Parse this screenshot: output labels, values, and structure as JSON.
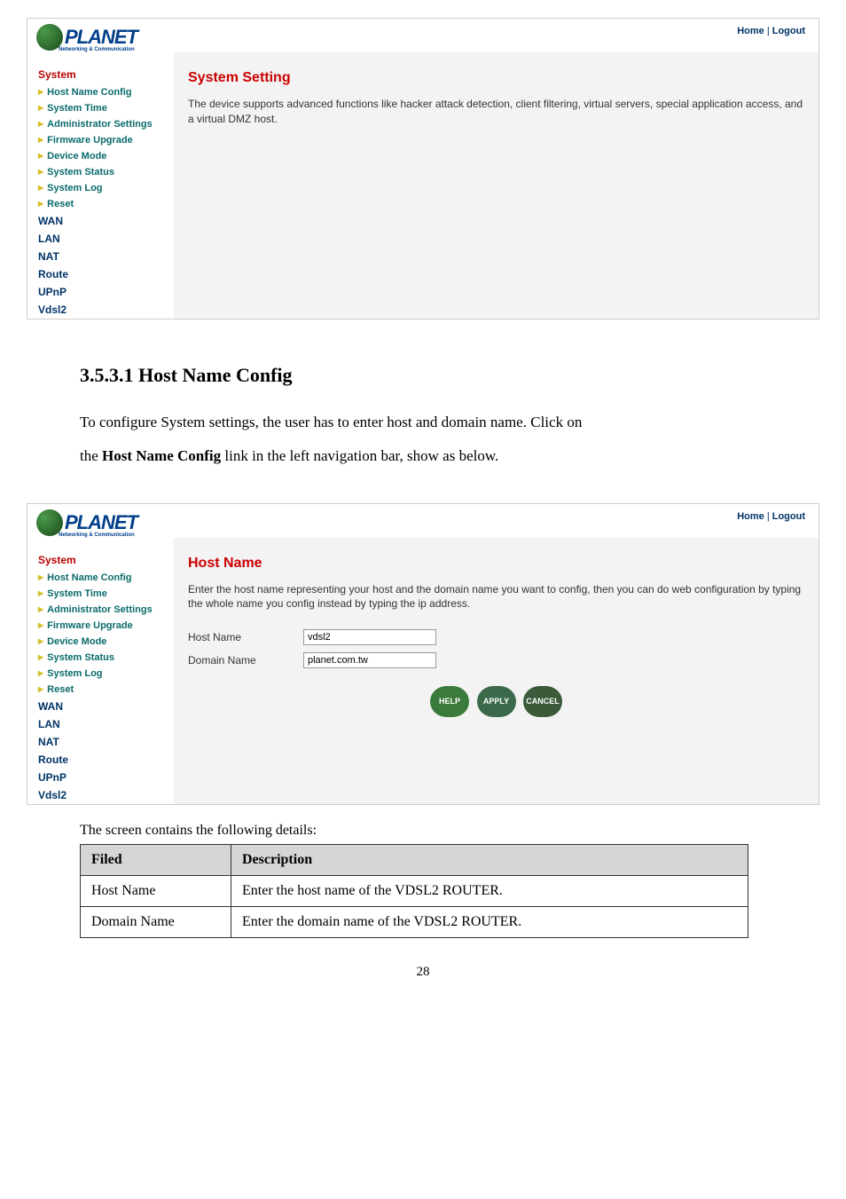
{
  "screenshot1": {
    "topbar": {
      "home": "Home",
      "sep": " | ",
      "logout": "Logout"
    },
    "logo": {
      "text": "PLANET",
      "sub": "Networking & Communication"
    },
    "sidebar": {
      "system": "System",
      "subs": [
        "Host Name Config",
        "System Time",
        "Administrator Settings",
        "Firmware Upgrade",
        "Device Mode",
        "System Status",
        "System Log",
        "Reset"
      ],
      "mains": [
        "WAN",
        "LAN",
        "NAT",
        "Route",
        "UPnP",
        "Vdsl2"
      ]
    },
    "content": {
      "title": "System Setting",
      "desc": "The device supports advanced functions like hacker attack detection, client filtering, virtual servers, special application access, and a virtual DMZ host."
    }
  },
  "mid": {
    "heading": "3.5.3.1 Host Name Config",
    "para1": "To configure System settings, the user has to enter host and domain name. Click on",
    "para2a": "the ",
    "para2b": "Host Name Config",
    "para2c": " link in the left navigation bar, show as below."
  },
  "screenshot2": {
    "topbar": {
      "home": "Home",
      "sep": " | ",
      "logout": "Logout"
    },
    "logo": {
      "text": "PLANET",
      "sub": "Networking & Communication"
    },
    "sidebar": {
      "system": "System",
      "subs": [
        "Host Name Config",
        "System Time",
        "Administrator Settings",
        "Firmware Upgrade",
        "Device Mode",
        "System Status",
        "System Log",
        "Reset"
      ],
      "mains": [
        "WAN",
        "LAN",
        "NAT",
        "Route",
        "UPnP",
        "Vdsl2"
      ]
    },
    "content": {
      "title": "Host Name",
      "desc": "Enter the host name representing your host and the domain name you want to config, then you can do web configuration by typing the whole name you config instead by typing the ip address.",
      "hostname_label": "Host Name",
      "hostname_value": "vdsl2",
      "domain_label": "Domain Name",
      "domain_value": "planet.com.tw",
      "btn_help": "HELP",
      "btn_apply": "APPLY",
      "btn_cancel": "CANCEL"
    }
  },
  "table": {
    "caption": "The screen contains the following details:",
    "headers": [
      "Filed",
      "Description"
    ],
    "rows": [
      [
        "Host Name",
        "Enter the host name of the VDSL2 ROUTER."
      ],
      [
        "Domain Name",
        "Enter the domain name of the VDSL2 ROUTER."
      ]
    ]
  },
  "page_num": "28"
}
